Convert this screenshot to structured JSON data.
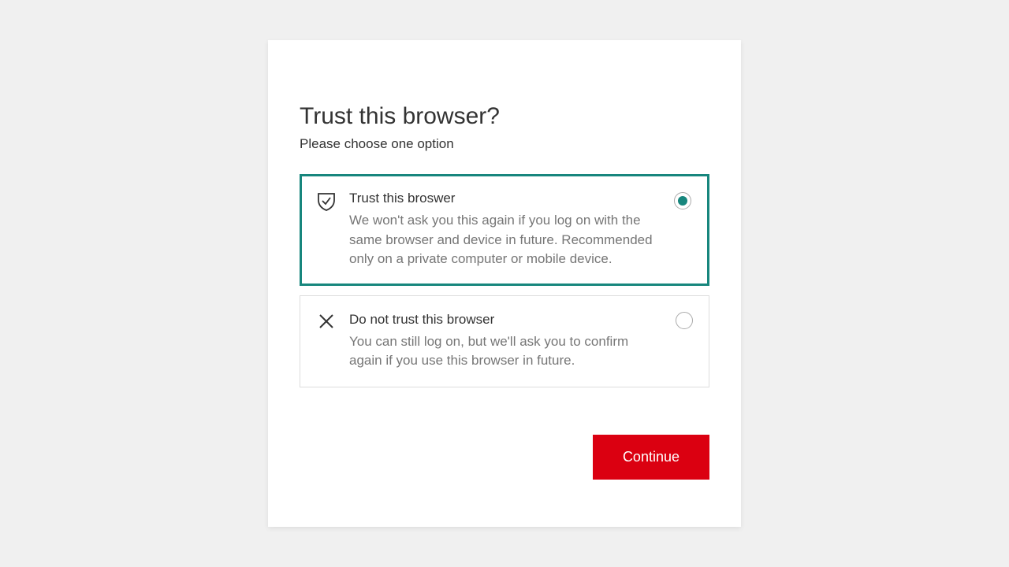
{
  "dialog": {
    "title": "Trust this browser?",
    "subtitle": "Please choose one option"
  },
  "options": {
    "trust": {
      "title": "Trust this broswer",
      "desc": "We won't ask you this again if you log on with the same browser and device in future. Recommended only on a private computer or mobile device.",
      "selected": true
    },
    "dont_trust": {
      "title": "Do not trust this browser",
      "desc": "You can still log on, but we'll ask you to confirm again if you use this browser in future.",
      "selected": false
    }
  },
  "buttons": {
    "continue": "Continue"
  }
}
